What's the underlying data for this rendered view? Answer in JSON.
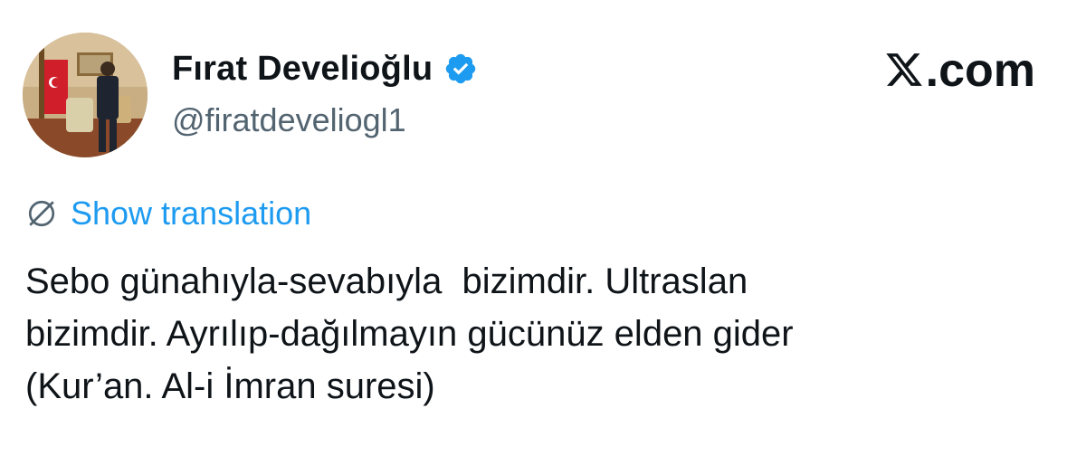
{
  "author": {
    "display_name": "Fırat Develioğlu",
    "handle": "@firatdeveliogl1",
    "verified": true,
    "avatar_icon": "profile-photo"
  },
  "brand": {
    "label": ".com",
    "icon": "x-logo-icon"
  },
  "translation": {
    "label": "Show translation",
    "icon": "globe-icon",
    "color": "#1d9bf0"
  },
  "tweet": {
    "lines": [
      "Sebo günahıyla-sevabıyla  bizimdir. Ultraslan",
      "bizimdir. Ayrılıp-dağılmayın gücünüz elden gider",
      "(Kur’an. Al-i İmran suresi)"
    ]
  },
  "colors": {
    "text": "#0f1419",
    "secondary": "#536471",
    "accent": "#1d9bf0",
    "background": "#ffffff"
  }
}
